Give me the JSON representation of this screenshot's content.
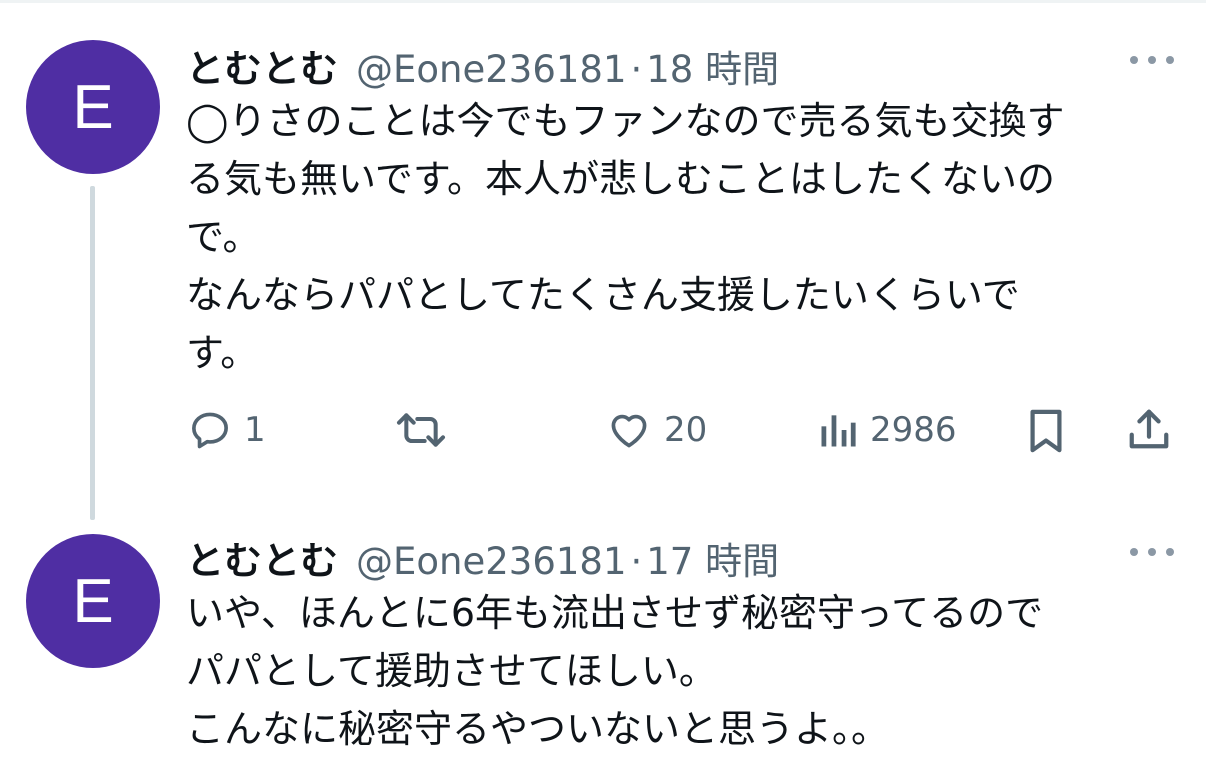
{
  "tweets": [
    {
      "avatar_letter": "E",
      "display_name": "とむとむ",
      "handle": "@Eone236181",
      "separator": "·",
      "time": "18 時間",
      "body_lines": [
        "◯りさのことは今でもファンなので売る気も交換す",
        "る気も無いです。本人が悲しむことはしたくないの",
        "で。",
        "なんならパパとしてたくさん支援したいくらいで",
        "す。"
      ],
      "actions": {
        "reply_count": "1",
        "retweet_count": "",
        "like_count": "20",
        "views_count": "2986"
      }
    },
    {
      "avatar_letter": "E",
      "display_name": "とむとむ",
      "handle": "@Eone236181",
      "separator": "·",
      "time": "17 時間",
      "body_lines": [
        "いや、ほんとに6年も流出させず秘密守ってるので",
        "パパとして援助させてほしい。",
        "こんなに秘密守るやついないと思うよ。。"
      ]
    }
  ],
  "icons": {
    "reply": "reply-icon",
    "retweet": "retweet-icon",
    "like": "like-icon",
    "views": "views-icon",
    "bookmark": "bookmark-icon",
    "share": "share-icon",
    "more": "more-icon"
  },
  "colors": {
    "avatar_bg": "#4f2ea3",
    "secondary_text": "#536471",
    "thread_line": "#cfd9de"
  }
}
